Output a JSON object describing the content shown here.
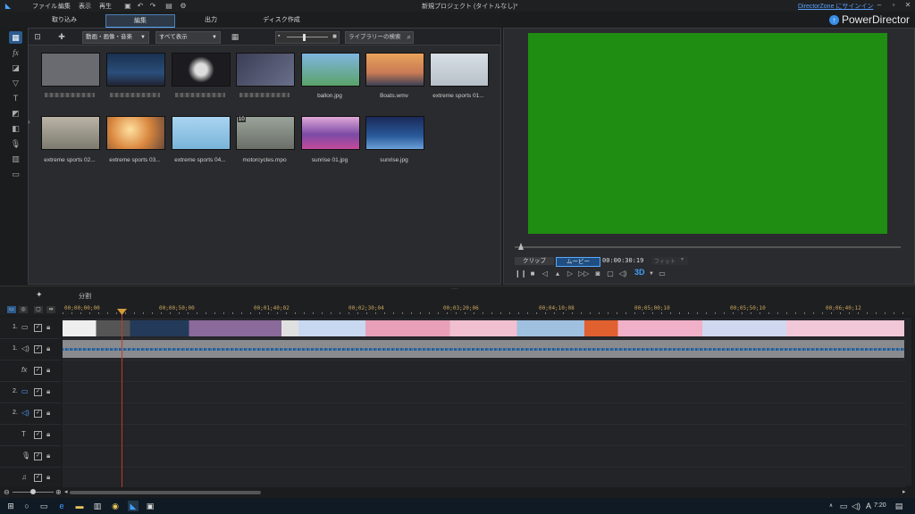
{
  "menu": {
    "items": [
      "ファイル",
      "編集",
      "表示",
      "再生"
    ]
  },
  "window": {
    "title": "新規プロジェクト (タイトルなし)*",
    "signin_link": "DirectorZone にサインイン",
    "app_name": "PowerDirector"
  },
  "tabs": [
    {
      "label": "取り込み",
      "active": false
    },
    {
      "label": "編集",
      "active": true
    },
    {
      "label": "出力",
      "active": false
    },
    {
      "label": "ディスク作成",
      "active": false
    }
  ],
  "library": {
    "filter_dropdown": "動画・画像・音楽",
    "view_dropdown": "すべて表示",
    "search_placeholder": "ライブラリーの検索",
    "items": [
      {
        "label": "",
        "color": "#6a6b70"
      },
      {
        "label": "",
        "color": "#2a4f7a"
      },
      {
        "label": "",
        "color": "#1c1c20"
      },
      {
        "label": "",
        "color": "#3a3d55"
      },
      {
        "label": "ballon.jpg",
        "color": "#5aa36a"
      },
      {
        "label": "Boats.wmv",
        "color": "#c97a55"
      },
      {
        "label": "extreme sports 01...",
        "color": "#b7c0c8"
      },
      {
        "label": "extreme sports 02...",
        "color": "#7d7a70"
      },
      {
        "label": "extreme sports 03...",
        "color": "#d9873f"
      },
      {
        "label": "extreme sports 04...",
        "color": "#7ab4d8"
      },
      {
        "label": "motorcycles.mpo",
        "color": "#6a6f68"
      },
      {
        "label": "sunrise 01.jpg",
        "color": "#7b4aa6"
      },
      {
        "label": "sunrise.jpg",
        "color": "#2a5a9a"
      }
    ],
    "motorcycles_badge": "10"
  },
  "preview": {
    "screen_color": "#1f8c12",
    "clip_label": "クリップ",
    "movie_label": "ムービー",
    "timecode": "00:00:30:19",
    "fit_label": "フィット",
    "three_d_label": "3D"
  },
  "timeline": {
    "split_label": "分割",
    "ruler_labels": [
      "00;00;00;00",
      "00;00;50;00",
      "00;01;40;02",
      "00;02;30;04",
      "00;03;20;06",
      "00;04;10;08",
      "00;05;00;10",
      "00;05;50;10",
      "00;06;40;12"
    ],
    "tracks": [
      {
        "num": "1.",
        "icon": "▭",
        "checked": "✓"
      },
      {
        "num": "1.",
        "icon": "◁)",
        "checked": "✓"
      },
      {
        "num": "",
        "icon": "fx",
        "checked": "✓"
      },
      {
        "num": "2.",
        "icon": "▭",
        "checked": "✓"
      },
      {
        "num": "2.",
        "icon": "◁)",
        "checked": "✓"
      },
      {
        "num": "",
        "icon": "T",
        "checked": "✓"
      },
      {
        "num": "",
        "icon": "🎙",
        "checked": "✓"
      },
      {
        "num": "",
        "icon": "♫",
        "checked": "✓"
      }
    ]
  },
  "taskbar": {
    "time": "7:20"
  }
}
